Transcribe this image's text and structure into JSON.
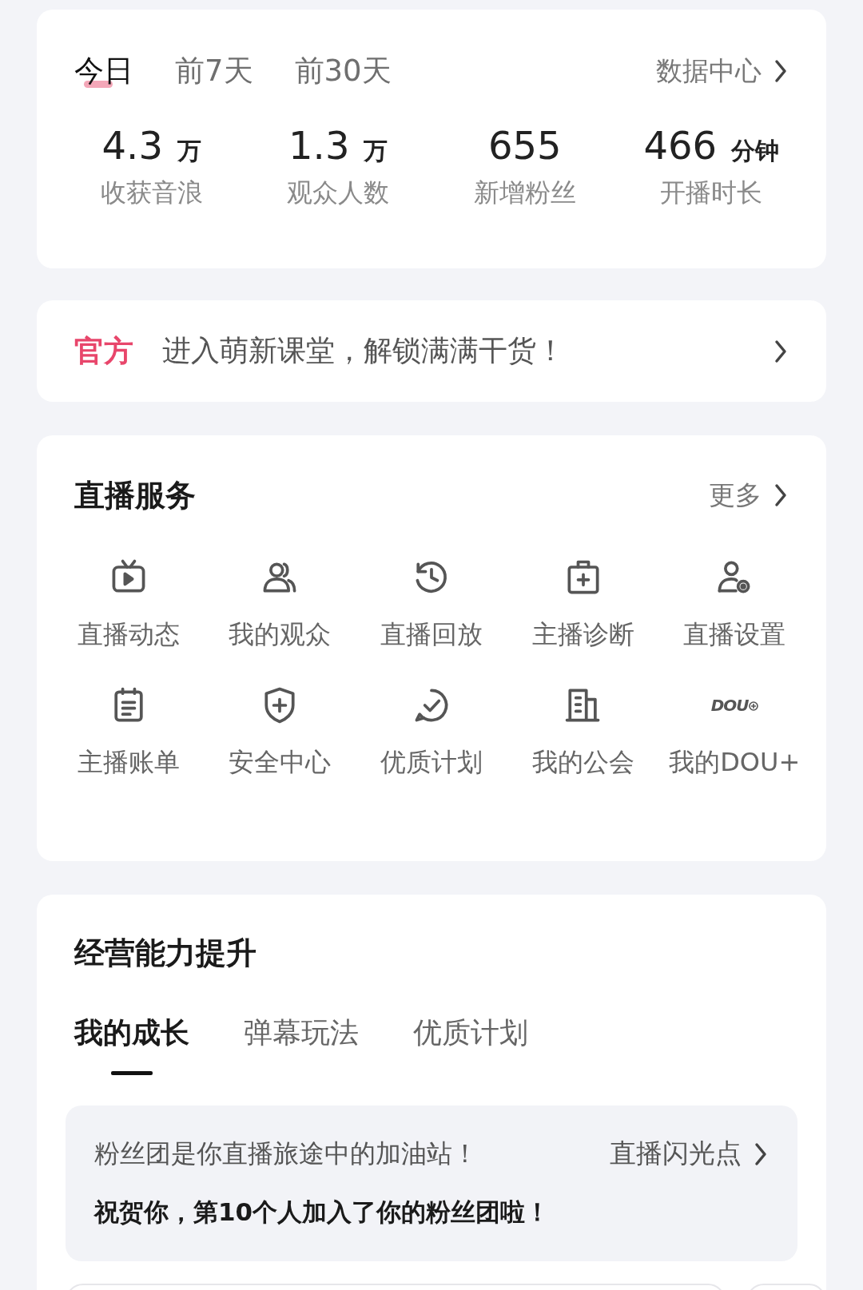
{
  "overview": {
    "tabs": [
      {
        "label": "今日",
        "selected": true
      },
      {
        "label": "前7天",
        "selected": false
      },
      {
        "label": "前30天",
        "selected": false
      }
    ],
    "link": "数据中心",
    "stats": [
      {
        "value": "4.3",
        "unit": "万",
        "label": "收获音浪"
      },
      {
        "value": "1.3",
        "unit": "万",
        "label": "观众人数"
      },
      {
        "value": "655",
        "label": "新增粉丝"
      },
      {
        "value": "466",
        "unit": "分钟",
        "label": "开播时长"
      }
    ]
  },
  "banner": {
    "tag": "官方",
    "text": "进入萌新课堂，解锁满满干货！"
  },
  "services": {
    "title": "直播服务",
    "more": "更多",
    "items": [
      {
        "label": "直播动态"
      },
      {
        "label": "我的观众"
      },
      {
        "label": "直播回放"
      },
      {
        "label": "主播诊断"
      },
      {
        "label": "直播设置"
      },
      {
        "label": "主播账单"
      },
      {
        "label": "安全中心"
      },
      {
        "label": "优质计划"
      },
      {
        "label": "我的公会"
      },
      {
        "label": "我的DOU+",
        "logo_text": "DOU"
      }
    ]
  },
  "growth": {
    "title": "经营能力提升",
    "tabs": [
      {
        "label": "我的成长",
        "selected": true
      },
      {
        "label": "弹幕玩法",
        "selected": false
      },
      {
        "label": "优质计划",
        "selected": false
      }
    ],
    "notice": {
      "text": "粉丝团是你直播旅途中的加油站！",
      "link": "直播闪光点",
      "message": "祝贺你，第10个人加入了你的粉丝团啦！"
    }
  }
}
